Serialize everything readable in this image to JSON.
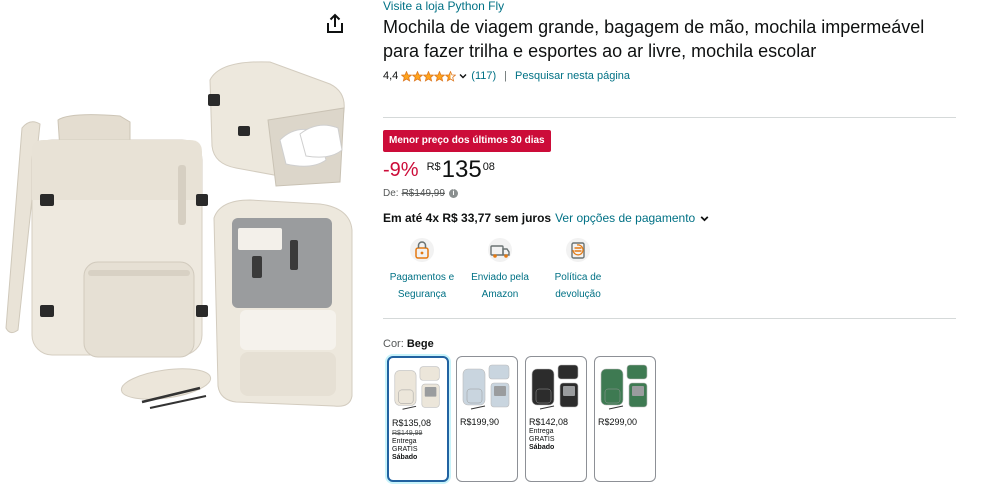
{
  "store": {
    "link_text": "Visite a loja Python Fly"
  },
  "product": {
    "title": "Mochila de viagem grande, bagagem de mão, mochila impermeável para fazer trilha e esportes ao ar livre, mochila escolar",
    "rating": "4,4",
    "stars": 4.5,
    "review_count": "(117)",
    "search_page_label": "Pesquisar nesta página"
  },
  "deal": {
    "badge": "Menor preço dos últimos 30 dias"
  },
  "price": {
    "discount": "-9%",
    "currency": "R$",
    "whole": "135",
    "fraction": "08",
    "list_label": "De:",
    "list_price": "R$149,99",
    "info_icon": "i"
  },
  "installment": {
    "text": "Em até 4x R$ 33,77 sem juros",
    "options_link": "Ver opções de pagamento"
  },
  "features": [
    {
      "icon": "secure-payment-icon",
      "line1": "Pagamentos e",
      "line2": "Segurança"
    },
    {
      "icon": "delivery-truck-icon",
      "line1": "Enviado pela",
      "line2": "Amazon"
    },
    {
      "icon": "return-policy-icon",
      "line1": "Política de",
      "line2": "devolução"
    }
  ],
  "color": {
    "label": "Cor:",
    "selected": "Bege"
  },
  "variants": [
    {
      "color_name": "beige",
      "hex": "#ece6da",
      "price": "R$135,08",
      "old_price": "R$149,99",
      "delivery1": "Entrega",
      "delivery2": "GRATIS",
      "delivery3": "Sábado"
    },
    {
      "color_name": "light-blue",
      "hex": "#c9d5df",
      "price": "R$199,90",
      "old_price": "",
      "delivery1": "",
      "delivery2": "",
      "delivery3": ""
    },
    {
      "color_name": "black",
      "hex": "#2c2c2c",
      "price": "R$142,08",
      "old_price": "",
      "delivery1": "Entrega",
      "delivery2": "GRATIS",
      "delivery3": "Sábado"
    },
    {
      "color_name": "green",
      "hex": "#3e7a52",
      "price": "R$299,00",
      "old_price": "",
      "delivery1": "",
      "delivery2": "",
      "delivery3": ""
    }
  ],
  "colors": {
    "link": "#007185",
    "deal": "#cc0c39",
    "star": "#ffa41c",
    "selected_border": "#2162a1"
  }
}
